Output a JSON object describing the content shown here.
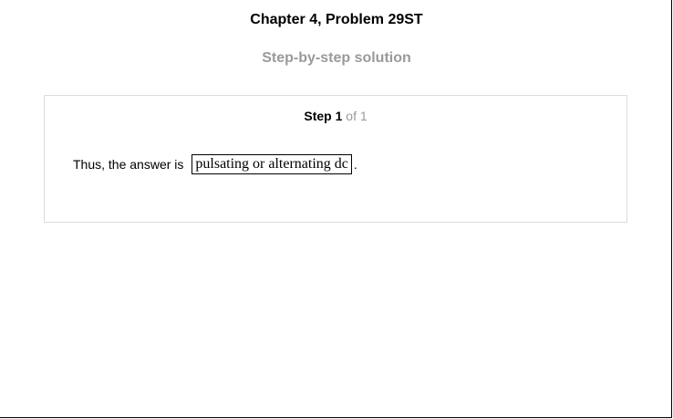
{
  "page": {
    "title": "Chapter 4, Problem 29ST",
    "subtitle": "Step-by-step solution"
  },
  "step": {
    "label": "Step",
    "number": "1",
    "of_text": "of 1",
    "lead_text": "Thus, the answer is",
    "answer": "pulsating or alternating dc",
    "trailing": "."
  }
}
